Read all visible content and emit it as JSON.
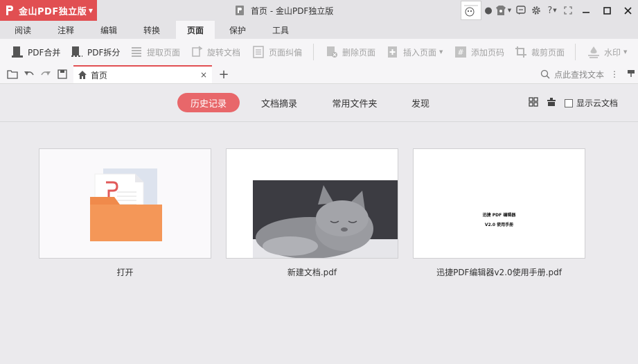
{
  "app": {
    "name": "金山PDF独立版",
    "window_title": "首页 - 金山PDF独立版",
    "accent": "#e14f52"
  },
  "menu_tabs": [
    "阅读",
    "注释",
    "编辑",
    "转换",
    "页面",
    "保护",
    "工具"
  ],
  "active_menu_tab": "页面",
  "ribbon": {
    "merge": "PDF合并",
    "split": "PDF拆分",
    "extract": "提取页面",
    "rotate": "旋转文档",
    "deskew": "页面纠偏",
    "delete": "删除页面",
    "insert": "插入页面",
    "page_number": "添加页码",
    "crop": "裁剪页面",
    "watermark": "水印"
  },
  "doc_tab": {
    "label": "首页",
    "close": "×"
  },
  "new_tab": "+",
  "find": {
    "placeholder": "点此查找文本"
  },
  "subnav": {
    "history": "历史记录",
    "summary": "文档摘录",
    "folders": "常用文件夹",
    "discover": "发现",
    "show_cloud": "显示云文档"
  },
  "files": [
    {
      "caption": "打开"
    },
    {
      "caption": "新建文档.pdf"
    },
    {
      "caption": "迅捷PDF编辑器v2.0使用手册.pdf",
      "preview_line1": "迅捷 PDF 编辑器",
      "preview_line2": "V2.0 使用手册"
    }
  ]
}
